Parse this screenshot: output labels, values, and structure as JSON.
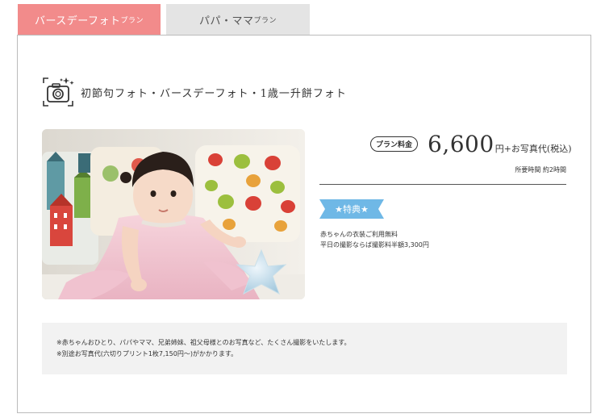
{
  "tabs": [
    {
      "label": "バースデーフォト",
      "suffix": "プラン",
      "active": true
    },
    {
      "label": "パパ・ママ",
      "suffix": "プラン",
      "active": false
    }
  ],
  "plan": {
    "icon": "camera-sparkle-icon",
    "title": "初節句フォト・バースデーフォト・1歳一升餅フォト",
    "price_badge": "プラン料金",
    "price": "6,600",
    "price_suffix": "円+お写真代(税込)",
    "duration": "所要時間 約2時間"
  },
  "benefit": {
    "label": "★特典★",
    "items": [
      "赤ちゃんの衣装ご利用無料",
      "平日の撮影ならば撮影料半額3,300円"
    ]
  },
  "notes": [
    "※赤ちゃんおひとり、パパやママ、兄弟姉妹、祖父母様とのお写真など、たくさん撮影をいたします。",
    "※別途お写真代(六切りプリント1枚7,150円〜)がかかります。"
  ],
  "colors": {
    "tab_active": "#f28b8b",
    "tab_inactive": "#e4e4e4",
    "ribbon": "#6fb8e6",
    "note_bg": "#f2f2f2"
  }
}
